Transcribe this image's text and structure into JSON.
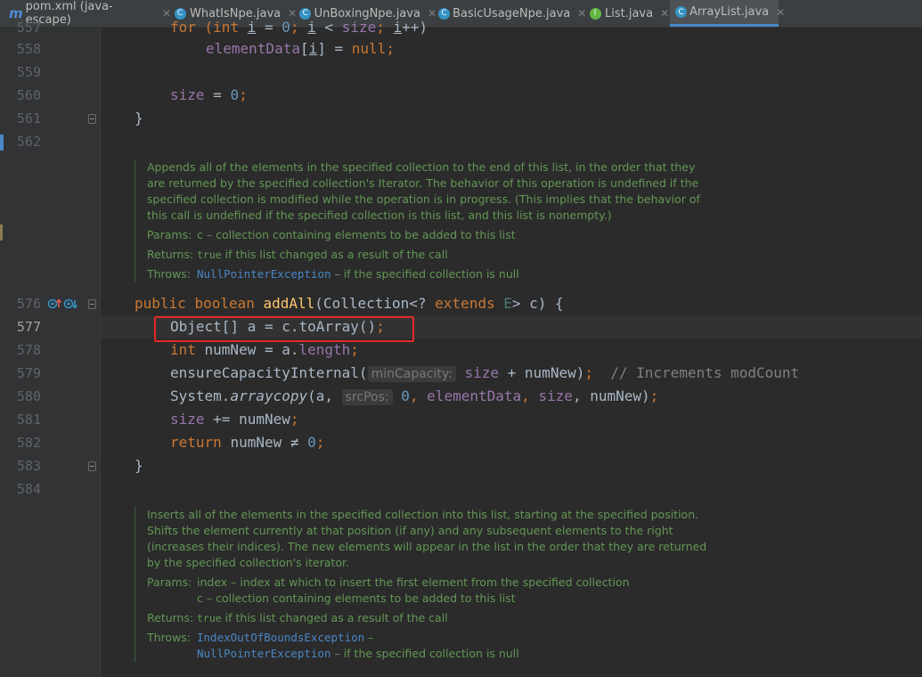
{
  "tabs": [
    {
      "label": "pom.xml (java-escape)",
      "icon": "maven-m-icon",
      "letter": "m",
      "active": false
    },
    {
      "label": "WhatIsNpe.java",
      "icon": "java-class-icon",
      "letter": "C",
      "active": false
    },
    {
      "label": "UnBoxingNpe.java",
      "icon": "java-class-icon",
      "letter": "C",
      "active": false
    },
    {
      "label": "BasicUsageNpe.java",
      "icon": "java-class-icon",
      "letter": "C",
      "active": false
    },
    {
      "label": "List.java",
      "icon": "java-interface-icon",
      "letter": "I",
      "active": false
    },
    {
      "label": "ArrayList.java",
      "icon": "java-class-icon",
      "letter": "C",
      "active": true
    }
  ],
  "tab_close_glyph": "✕",
  "line_numbers": {
    "557": "557",
    "558": "558",
    "559": "559",
    "560": "560",
    "561": "561",
    "562": "562",
    "576": "576",
    "577": "577",
    "578": "578",
    "579": "579",
    "580": "580",
    "581": "581",
    "582": "582",
    "583": "583",
    "584": "584"
  },
  "code": {
    "l557": {
      "a": "for (",
      "b": "int ",
      "c": "i",
      "d": " = ",
      "e": "0",
      "f": "; ",
      "g": "i",
      "h": " < ",
      "i": "size",
      "j": "; ",
      "k": "i",
      "l": "++)"
    },
    "l558": {
      "a": "elementData",
      "b": "[",
      "c": "i",
      "d": "] = ",
      "e": "null",
      "f": ";"
    },
    "l560": {
      "a": "size",
      "b": " = ",
      "c": "0",
      "d": ";"
    },
    "l561": "}",
    "l576": {
      "a": "public ",
      "b": "boolean ",
      "c": "addAll",
      "d": "(Collection<? ",
      "e": "extends ",
      "f": "E",
      "g": "> c) {"
    },
    "l577": {
      "a": "Object[] a = c.toArray()",
      "b": ";"
    },
    "l578": {
      "a": "int ",
      "b": "numNew = a.",
      "c": "length",
      "d": ";"
    },
    "l579": {
      "a": "ensureCapacityInternal(",
      "hint": "minCapacity:",
      "b": " size",
      "c": " + numNew)",
      "d": ";",
      "e": "  // Increments modCount"
    },
    "l580": {
      "a": "System.",
      "b": "arraycopy",
      "c": "(a, ",
      "hint": "srcPos:",
      "d": " 0",
      "e": ", ",
      "f": "elementData",
      "g": ", ",
      "h": "size",
      "i": ", numNew)",
      "j": ";"
    },
    "l581": {
      "a": "size",
      "b": " += numNew",
      "c": ";"
    },
    "l582": {
      "a": "return ",
      "b": "numNew ",
      "c": "≠",
      "d": " 0",
      "e": ";"
    },
    "l583": "}"
  },
  "doc1": {
    "text": [
      "Appends all of the elements in the specified collection to the end of this list, in the order that they",
      "are returned by the specified collection's Iterator. The behavior of this operation is undefined if the",
      "specified collection is modified while the operation is in progress. (This implies that the behavior of",
      "this call is undefined if the specified collection is this list, and this list is nonempty.)"
    ],
    "params_label": "Params:",
    "params": "c – collection containing elements to be added to this list",
    "returns_label": "Returns:",
    "returns_code": "true",
    "returns": " if this list changed as a result of the call",
    "throws_label": "Throws:",
    "throws_link": "NullPointerException",
    "throws": " – if the specified collection is null"
  },
  "doc2": {
    "text": [
      "Inserts all of the elements in the specified collection into this list, starting at the specified position.",
      "Shifts the element currently at that position (if any) and any subsequent elements to the right",
      "(increases their indices). The new elements will appear in the list in the order that they are returned",
      "by the specified collection's iterator."
    ],
    "params_label": "Params:",
    "params1": "index – index at which to insert the first element from the specified collection",
    "params2": "c – collection containing elements to be added to this list",
    "returns_label": "Returns:",
    "returns_code": "true",
    "returns": " if this list changed as a result of the call",
    "throws_label": "Throws:",
    "throws_link1": "IndexOutOfBoundsException",
    "throws1": " –",
    "throws_link2": "NullPointerException",
    "throws2": " – if the specified collection is null"
  },
  "colors": {
    "background": "#2b2b2b",
    "keyword": "#cc7832",
    "number": "#6897bb",
    "field": "#9876aa",
    "doc": "#629755",
    "highlight_box": "#e62828"
  }
}
